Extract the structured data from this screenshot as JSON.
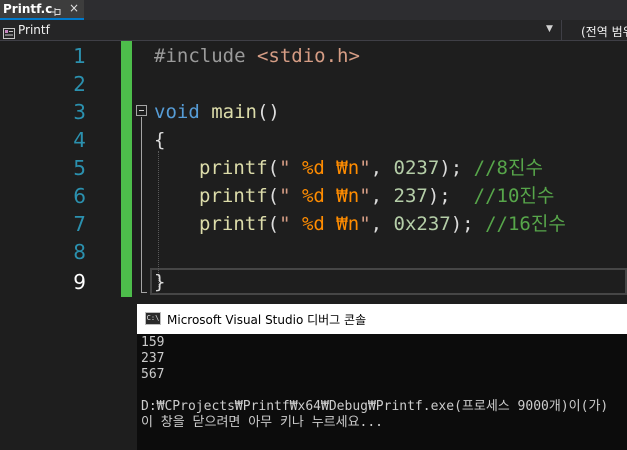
{
  "tab": {
    "title": "Printf.c",
    "close_glyph": "×"
  },
  "navbar": {
    "scope_label": "Printf",
    "member_label": "(전역 범위)"
  },
  "editor": {
    "line_numbers": [
      "1",
      "2",
      "3",
      "4",
      "5",
      "6",
      "7",
      "8",
      "9"
    ],
    "current_line": "9",
    "lines": {
      "l1": {
        "directive": "#include ",
        "header": "<stdio.h>"
      },
      "l3": {
        "keyword": "void",
        "space": " ",
        "name": "main",
        "paren": "()"
      },
      "l4": {
        "brace": "{"
      },
      "l5": {
        "func": "printf",
        "open": "(",
        "str_a": "\" ",
        "fmt": "%d ₩n",
        "str_b": "\"",
        "sep": ", ",
        "num": "0237",
        "close": ");",
        "gap": " ",
        "comment": "//8진수"
      },
      "l6": {
        "func": "printf",
        "open": "(",
        "str_a": "\" ",
        "fmt": "%d ₩n",
        "str_b": "\"",
        "sep": ", ",
        "num": "237",
        "close": ");",
        "gap": "  ",
        "comment": "//10진수"
      },
      "l7": {
        "func": "printf",
        "open": "(",
        "str_a": "\" ",
        "fmt": "%d ₩n",
        "str_b": "\"",
        "sep": ", ",
        "num": "0x237",
        "close": ");",
        "gap": " ",
        "comment": "//16진수"
      },
      "l9": {
        "brace": "}"
      }
    }
  },
  "console": {
    "title": "Microsoft Visual Studio 디버그 콘솔",
    "icon_text": "C:\\",
    "output": [
      "159",
      "237",
      "567"
    ],
    "exit_message": "D:₩CProjects₩Printf₩x64₩Debug₩Printf.exe(프로세스 9000개)이(가)",
    "close_prompt": "이 창을 닫으려면 아무 키나 누르세요..."
  },
  "colors": {
    "editor_bg": "#1e1e1e",
    "line_number": "#2b91af",
    "keyword": "#569cd6",
    "function": "#dcdcaa",
    "string": "#d69d85",
    "format": "#ff8c00",
    "number": "#b5cea8",
    "comment": "#57a64a",
    "preprocessor": "#9b9b9b",
    "change_margin": "#4dbd4b",
    "tab_accent": "#007acc"
  }
}
